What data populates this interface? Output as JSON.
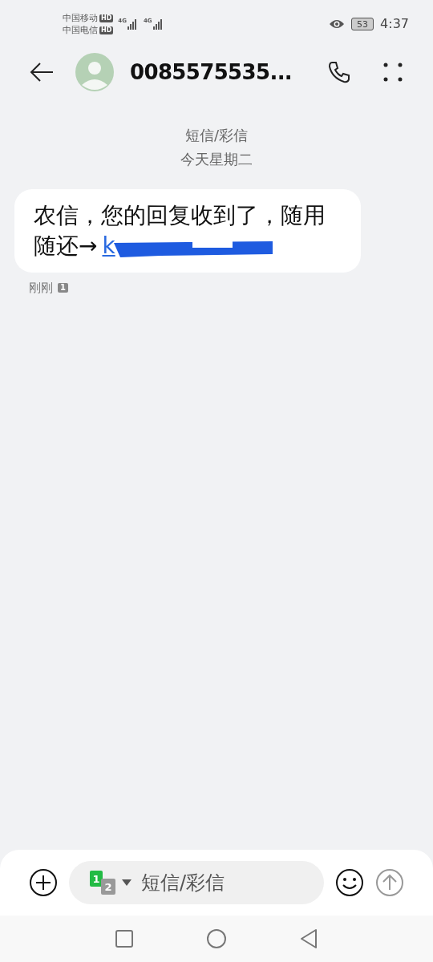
{
  "status_bar": {
    "carriers": [
      {
        "name": "中国移动",
        "badge": "HD",
        "network": "4G"
      },
      {
        "name": "中国电信",
        "badge": "HD",
        "network": "4G"
      }
    ],
    "battery": "53",
    "time": "4:37"
  },
  "header": {
    "contact": "0085575535..."
  },
  "conversation": {
    "channel": "短信/彩信",
    "date": "今天星期二",
    "messages": [
      {
        "text": "农信，您的回复收到了，随用随还→",
        "link": "k",
        "redacted": true,
        "time": "刚刚",
        "sim": "1"
      }
    ]
  },
  "composer": {
    "sims": [
      "1",
      "2"
    ],
    "placeholder": "短信/彩信"
  }
}
